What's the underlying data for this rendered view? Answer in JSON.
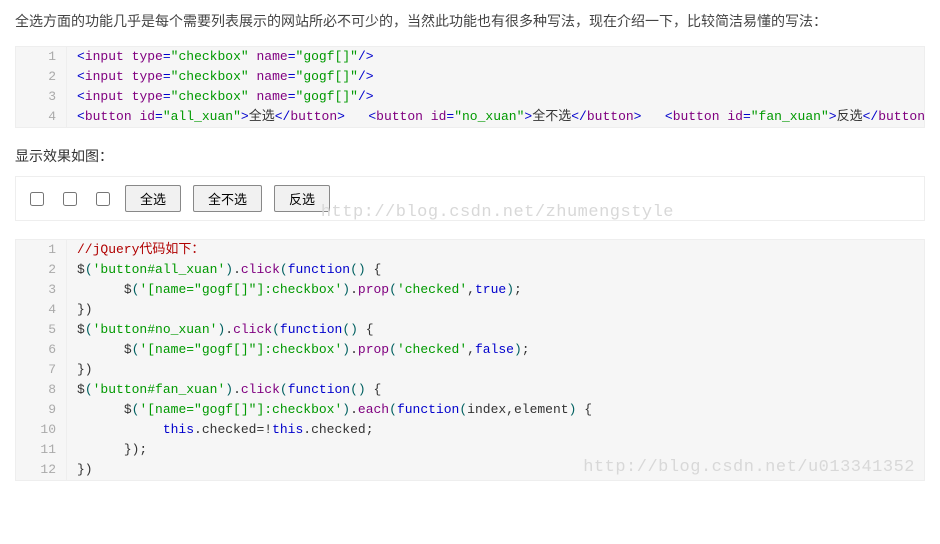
{
  "intro_text": "全选方面的功能几乎是每个需要列表展示的网站所必不可少的，当然此功能也有很多种写法，现在介绍一下，比较简洁易懂的写法：",
  "demo_caption": "显示效果如图：",
  "demo_buttons": {
    "all": "全选",
    "none": "全不选",
    "invert": "反选"
  },
  "watermark1": "http://blog.csdn.net/zhumengstyle",
  "watermark2": "http://blog.csdn.net/u013341352",
  "code1": {
    "lines": [
      {
        "n": "1",
        "tokens": [
          {
            "c": "tok-angle",
            "t": "<"
          },
          {
            "c": "tok-tag",
            "t": "input"
          },
          {
            "c": "tok-plain",
            "t": " "
          },
          {
            "c": "tok-attr",
            "t": "type"
          },
          {
            "c": "tok-eq",
            "t": "="
          },
          {
            "c": "tok-str",
            "t": "\"checkbox\""
          },
          {
            "c": "tok-plain",
            "t": " "
          },
          {
            "c": "tok-attr",
            "t": "name"
          },
          {
            "c": "tok-eq",
            "t": "="
          },
          {
            "c": "tok-str",
            "t": "\"gogf[]\""
          },
          {
            "c": "tok-angle",
            "t": "/>"
          }
        ]
      },
      {
        "n": "2",
        "tokens": [
          {
            "c": "tok-angle",
            "t": "<"
          },
          {
            "c": "tok-tag",
            "t": "input"
          },
          {
            "c": "tok-plain",
            "t": " "
          },
          {
            "c": "tok-attr",
            "t": "type"
          },
          {
            "c": "tok-eq",
            "t": "="
          },
          {
            "c": "tok-str",
            "t": "\"checkbox\""
          },
          {
            "c": "tok-plain",
            "t": " "
          },
          {
            "c": "tok-attr",
            "t": "name"
          },
          {
            "c": "tok-eq",
            "t": "="
          },
          {
            "c": "tok-str",
            "t": "\"gogf[]\""
          },
          {
            "c": "tok-angle",
            "t": "/>"
          }
        ]
      },
      {
        "n": "3",
        "tokens": [
          {
            "c": "tok-angle",
            "t": "<"
          },
          {
            "c": "tok-tag",
            "t": "input"
          },
          {
            "c": "tok-plain",
            "t": " "
          },
          {
            "c": "tok-attr",
            "t": "type"
          },
          {
            "c": "tok-eq",
            "t": "="
          },
          {
            "c": "tok-str",
            "t": "\"checkbox\""
          },
          {
            "c": "tok-plain",
            "t": " "
          },
          {
            "c": "tok-attr",
            "t": "name"
          },
          {
            "c": "tok-eq",
            "t": "="
          },
          {
            "c": "tok-str",
            "t": "\"gogf[]\""
          },
          {
            "c": "tok-angle",
            "t": "/>"
          }
        ]
      },
      {
        "n": "4",
        "tokens": [
          {
            "c": "tok-angle",
            "t": "<"
          },
          {
            "c": "tok-tag",
            "t": "button"
          },
          {
            "c": "tok-plain",
            "t": " "
          },
          {
            "c": "tok-attr",
            "t": "id"
          },
          {
            "c": "tok-eq",
            "t": "="
          },
          {
            "c": "tok-str",
            "t": "\"all_xuan\""
          },
          {
            "c": "tok-angle",
            "t": ">"
          },
          {
            "c": "tok-plain",
            "t": "全选"
          },
          {
            "c": "tok-angle",
            "t": "</"
          },
          {
            "c": "tok-tag",
            "t": "button"
          },
          {
            "c": "tok-angle",
            "t": ">"
          },
          {
            "c": "tok-plain",
            "t": "   "
          },
          {
            "c": "tok-angle",
            "t": "<"
          },
          {
            "c": "tok-tag",
            "t": "button"
          },
          {
            "c": "tok-plain",
            "t": " "
          },
          {
            "c": "tok-attr",
            "t": "id"
          },
          {
            "c": "tok-eq",
            "t": "="
          },
          {
            "c": "tok-str",
            "t": "\"no_xuan\""
          },
          {
            "c": "tok-angle",
            "t": ">"
          },
          {
            "c": "tok-plain",
            "t": "全不选"
          },
          {
            "c": "tok-angle",
            "t": "</"
          },
          {
            "c": "tok-tag",
            "t": "button"
          },
          {
            "c": "tok-angle",
            "t": ">"
          },
          {
            "c": "tok-plain",
            "t": "   "
          },
          {
            "c": "tok-angle",
            "t": "<"
          },
          {
            "c": "tok-tag",
            "t": "button"
          },
          {
            "c": "tok-plain",
            "t": " "
          },
          {
            "c": "tok-attr",
            "t": "id"
          },
          {
            "c": "tok-eq",
            "t": "="
          },
          {
            "c": "tok-str",
            "t": "\"fan_xuan\""
          },
          {
            "c": "tok-angle",
            "t": ">"
          },
          {
            "c": "tok-plain",
            "t": "反选"
          },
          {
            "c": "tok-angle",
            "t": "</"
          },
          {
            "c": "tok-tag",
            "t": "button"
          },
          {
            "c": "tok-angle",
            "t": ">"
          }
        ]
      }
    ]
  },
  "code2": {
    "lines": [
      {
        "n": "1",
        "tokens": [
          {
            "c": "tok-comment",
            "t": "//jQuery代码如下："
          }
        ]
      },
      {
        "n": "2",
        "tokens": [
          {
            "c": "tok-jq",
            "t": "$"
          },
          {
            "c": "tok-paren",
            "t": "("
          },
          {
            "c": "tok-str",
            "t": "'button#all_xuan'"
          },
          {
            "c": "tok-paren",
            "t": ")"
          },
          {
            "c": "tok-jq",
            "t": "."
          },
          {
            "c": "tok-func",
            "t": "click"
          },
          {
            "c": "tok-paren",
            "t": "("
          },
          {
            "c": "tok-kw",
            "t": "function"
          },
          {
            "c": "tok-paren",
            "t": "()"
          },
          {
            "c": "tok-jq",
            "t": " {"
          }
        ]
      },
      {
        "n": "3",
        "tokens": [
          {
            "c": "tok-plain",
            "t": "      "
          },
          {
            "c": "tok-jq",
            "t": "$"
          },
          {
            "c": "tok-paren",
            "t": "("
          },
          {
            "c": "tok-str",
            "t": "'[name=\"gogf[]\"]:checkbox'"
          },
          {
            "c": "tok-paren",
            "t": ")"
          },
          {
            "c": "tok-jq",
            "t": "."
          },
          {
            "c": "tok-func",
            "t": "prop"
          },
          {
            "c": "tok-paren",
            "t": "("
          },
          {
            "c": "tok-str",
            "t": "'checked'"
          },
          {
            "c": "tok-jq",
            "t": ","
          },
          {
            "c": "tok-bool",
            "t": "true"
          },
          {
            "c": "tok-paren",
            "t": ")"
          },
          {
            "c": "tok-jq",
            "t": ";"
          }
        ]
      },
      {
        "n": "4",
        "tokens": [
          {
            "c": "tok-jq",
            "t": "})"
          }
        ]
      },
      {
        "n": "5",
        "tokens": [
          {
            "c": "tok-jq",
            "t": "$"
          },
          {
            "c": "tok-paren",
            "t": "("
          },
          {
            "c": "tok-str",
            "t": "'button#no_xuan'"
          },
          {
            "c": "tok-paren",
            "t": ")"
          },
          {
            "c": "tok-jq",
            "t": "."
          },
          {
            "c": "tok-func",
            "t": "click"
          },
          {
            "c": "tok-paren",
            "t": "("
          },
          {
            "c": "tok-kw",
            "t": "function"
          },
          {
            "c": "tok-paren",
            "t": "()"
          },
          {
            "c": "tok-jq",
            "t": " {"
          }
        ]
      },
      {
        "n": "6",
        "tokens": [
          {
            "c": "tok-plain",
            "t": "      "
          },
          {
            "c": "tok-jq",
            "t": "$"
          },
          {
            "c": "tok-paren",
            "t": "("
          },
          {
            "c": "tok-str",
            "t": "'[name=\"gogf[]\"]:checkbox'"
          },
          {
            "c": "tok-paren",
            "t": ")"
          },
          {
            "c": "tok-jq",
            "t": "."
          },
          {
            "c": "tok-func",
            "t": "prop"
          },
          {
            "c": "tok-paren",
            "t": "("
          },
          {
            "c": "tok-str",
            "t": "'checked'"
          },
          {
            "c": "tok-jq",
            "t": ","
          },
          {
            "c": "tok-bool",
            "t": "false"
          },
          {
            "c": "tok-paren",
            "t": ")"
          },
          {
            "c": "tok-jq",
            "t": ";"
          }
        ]
      },
      {
        "n": "7",
        "tokens": [
          {
            "c": "tok-jq",
            "t": "})"
          }
        ]
      },
      {
        "n": "8",
        "tokens": [
          {
            "c": "tok-jq",
            "t": "$"
          },
          {
            "c": "tok-paren",
            "t": "("
          },
          {
            "c": "tok-str",
            "t": "'button#fan_xuan'"
          },
          {
            "c": "tok-paren",
            "t": ")"
          },
          {
            "c": "tok-jq",
            "t": "."
          },
          {
            "c": "tok-func",
            "t": "click"
          },
          {
            "c": "tok-paren",
            "t": "("
          },
          {
            "c": "tok-kw",
            "t": "function"
          },
          {
            "c": "tok-paren",
            "t": "()"
          },
          {
            "c": "tok-jq",
            "t": " {"
          }
        ]
      },
      {
        "n": "9",
        "tokens": [
          {
            "c": "tok-plain",
            "t": "      "
          },
          {
            "c": "tok-jq",
            "t": "$"
          },
          {
            "c": "tok-paren",
            "t": "("
          },
          {
            "c": "tok-str",
            "t": "'[name=\"gogf[]\"]:checkbox'"
          },
          {
            "c": "tok-paren",
            "t": ")"
          },
          {
            "c": "tok-jq",
            "t": "."
          },
          {
            "c": "tok-func",
            "t": "each"
          },
          {
            "c": "tok-paren",
            "t": "("
          },
          {
            "c": "tok-kw",
            "t": "function"
          },
          {
            "c": "tok-paren",
            "t": "("
          },
          {
            "c": "tok-jq",
            "t": "index,element"
          },
          {
            "c": "tok-paren",
            "t": ")"
          },
          {
            "c": "tok-jq",
            "t": " {"
          }
        ]
      },
      {
        "n": "10",
        "tokens": [
          {
            "c": "tok-plain",
            "t": "           "
          },
          {
            "c": "tok-this",
            "t": "this"
          },
          {
            "c": "tok-jq",
            "t": ".checked=!"
          },
          {
            "c": "tok-this",
            "t": "this"
          },
          {
            "c": "tok-jq",
            "t": ".checked;"
          }
        ]
      },
      {
        "n": "11",
        "tokens": [
          {
            "c": "tok-plain",
            "t": "      "
          },
          {
            "c": "tok-jq",
            "t": "});"
          }
        ]
      },
      {
        "n": "12",
        "tokens": [
          {
            "c": "tok-jq",
            "t": "})"
          }
        ]
      }
    ]
  }
}
